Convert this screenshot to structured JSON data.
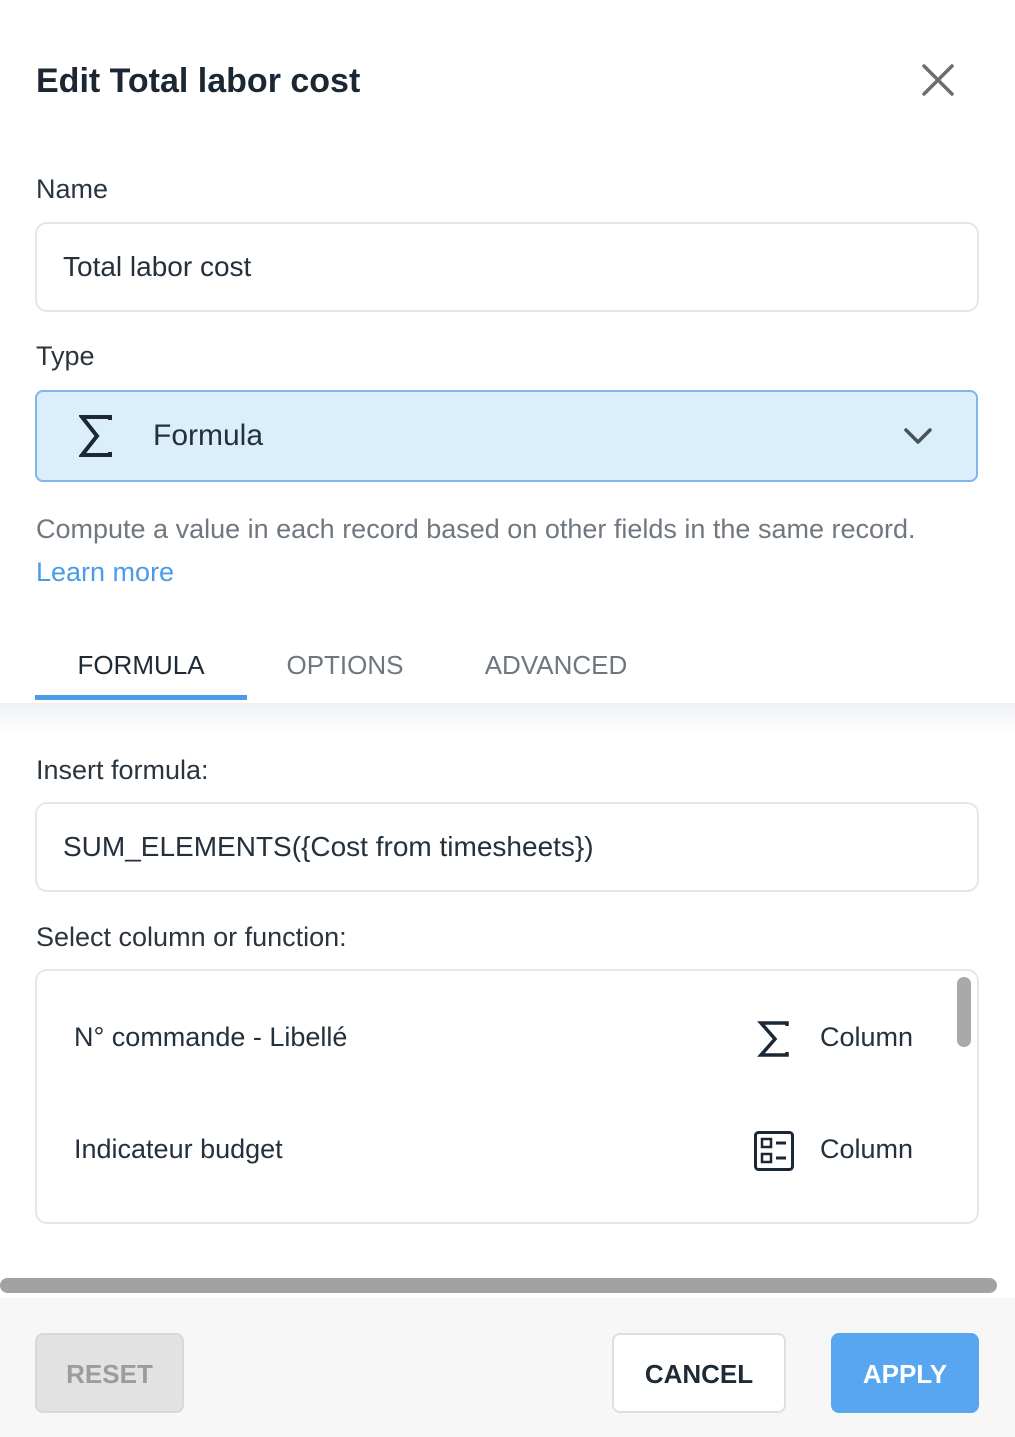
{
  "dialog": {
    "title": "Edit Total labor cost",
    "close_icon": "close-icon"
  },
  "name_field": {
    "label": "Name",
    "value": "Total labor cost"
  },
  "type_field": {
    "label": "Type",
    "icon": "sigma-icon",
    "value": "Formula",
    "dropdown_icon": "chevron-down-icon"
  },
  "description": {
    "text": "Compute a value in each record based on other fields in the same record.",
    "link": "Learn more"
  },
  "tabs": [
    {
      "label": "FORMULA",
      "active": true
    },
    {
      "label": "OPTIONS",
      "active": false
    },
    {
      "label": "ADVANCED",
      "active": false
    }
  ],
  "formula": {
    "label": "Insert formula:",
    "value": "SUM_ELEMENTS({Cost from timesheets})"
  },
  "picker": {
    "label": "Select column or function:",
    "items": [
      {
        "name": "N° commande - Libellé",
        "icon": "sigma-icon",
        "kind": "Column"
      },
      {
        "name": "Indicateur budget",
        "icon": "list-form-icon",
        "kind": "Column"
      }
    ]
  },
  "footer": {
    "reset": "RESET",
    "cancel": "CANCEL",
    "apply": "APPLY"
  },
  "colors": {
    "accent": "#4a9be8",
    "select_bg": "#dbeefc",
    "apply_bg": "#58a5f0"
  }
}
